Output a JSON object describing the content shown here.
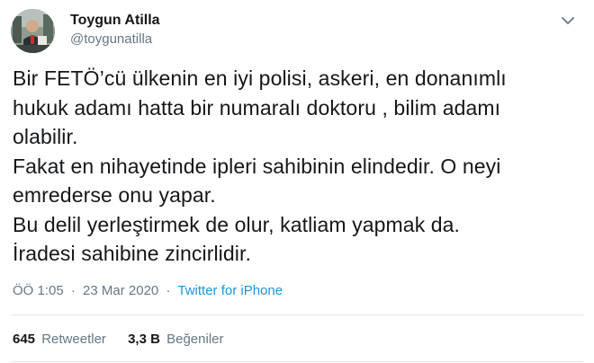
{
  "user": {
    "display_name": "Toygun Atilla",
    "handle": "@toygunatilla"
  },
  "tweet": {
    "lines": [
      "Bir FETÖ’cü ülkenin en iyi polisi, askeri, en donanımlı",
      "hukuk adamı hatta bir numaralı doktoru , bilim adamı",
      "olabilir.",
      "Fakat en nihayetinde ipleri sahibinin elindedir. O neyi",
      "emrederse onu yapar.",
      "Bu delil yerleştirmek de olur, katliam yapmak da.",
      "İradesi sahibine zincirlidir."
    ]
  },
  "meta": {
    "time": "ÖÖ 1:05",
    "separator": "·",
    "date": "23 Mar 2020",
    "source": "Twitter for iPhone"
  },
  "stats": {
    "retweets_count": "645",
    "retweets_label": "Retweetler",
    "likes_count": "3,3 B",
    "likes_label": "Beğeniler"
  },
  "icons": {
    "caret": "chevron-down-icon"
  },
  "colors": {
    "link": "#1b95e0",
    "secondary_text": "#657786",
    "primary_text": "#14171a",
    "divider": "#e1e8ed"
  }
}
